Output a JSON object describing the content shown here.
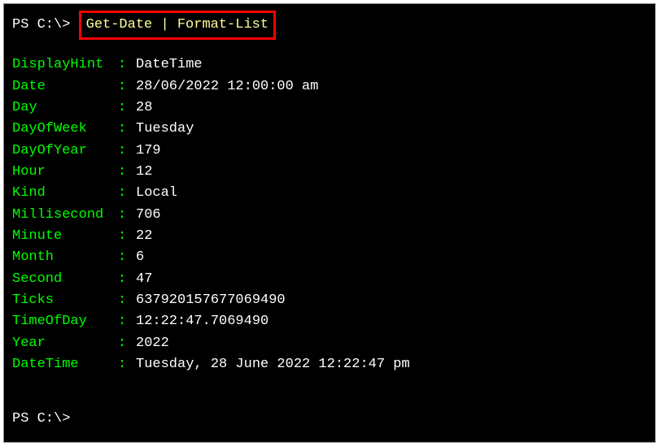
{
  "prompt1_prefix": "PS C:\\> ",
  "command": "Get-Date | Format-List",
  "rows": [
    {
      "name": "DisplayHint",
      "value": "DateTime"
    },
    {
      "name": "Date",
      "value": "28/06/2022 12:00:00 am"
    },
    {
      "name": "Day",
      "value": "28"
    },
    {
      "name": "DayOfWeek",
      "value": "Tuesday"
    },
    {
      "name": "DayOfYear",
      "value": "179"
    },
    {
      "name": "Hour",
      "value": "12"
    },
    {
      "name": "Kind",
      "value": "Local"
    },
    {
      "name": "Millisecond",
      "value": "706"
    },
    {
      "name": "Minute",
      "value": "22"
    },
    {
      "name": "Month",
      "value": "6"
    },
    {
      "name": "Second",
      "value": "47"
    },
    {
      "name": "Ticks",
      "value": "637920157677069490"
    },
    {
      "name": "TimeOfDay",
      "value": "12:22:47.7069490"
    },
    {
      "name": "Year",
      "value": "2022"
    },
    {
      "name": "DateTime",
      "value": "Tuesday, 28 June 2022 12:22:47 pm"
    }
  ],
  "prompt2": "PS C:\\>"
}
